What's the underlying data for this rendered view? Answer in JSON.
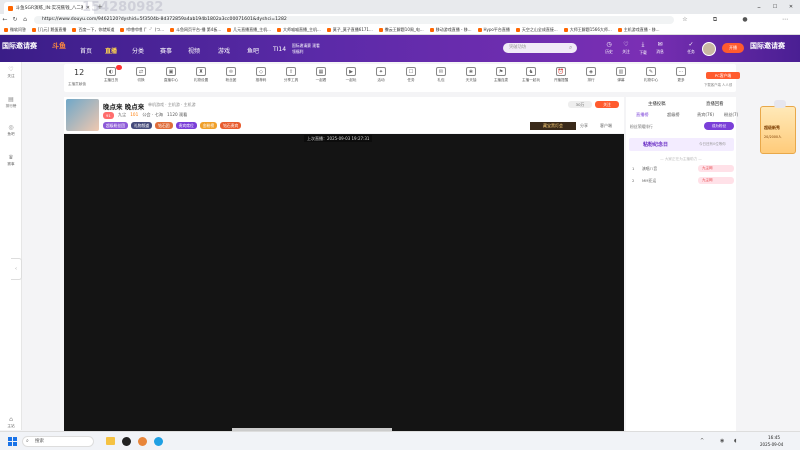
{
  "browser": {
    "tab_title": "斗鱼SGR演练_IN:实况蕉钱_八二赛",
    "url": "https://www.douyu.com/9462120?dyshid=5f3504b-8d372859a4ab194b1802a3cc00071601&dyshci=1282",
    "bookmarks": [
      "微软问答",
      "[几元] 鹅蛋直播",
      "百度一下，你就知道",
      "哔哩哔哩 (゜-゜)つ...",
      "斗鱼网页平台-播 第4板...",
      "几元直播直播_主机...",
      "大师喵喵直播_主机...",
      "莫子_莫子直播6171...",
      "撒云王解题10周_电...",
      "移动游戏直播 - 移...",
      "Hypo平台直播",
      "天空之山全成直接...",
      "大师王解题1566大师...",
      "主机游戏直播 - 移..."
    ]
  },
  "site": {
    "logo_left": "国际邀请赛",
    "logo_brand": "斗鱼",
    "nav": [
      "首页",
      "直播",
      "分类",
      "赛事",
      "视频",
      "游戏",
      "鱼吧",
      "TI14"
    ],
    "promo": "国际邀请赛 观看领福利",
    "search_placeholder": "突破功坊",
    "header_icons": [
      "历史",
      "关注",
      "下载",
      "消息",
      "任务"
    ],
    "right_logo": "国际邀请赛"
  },
  "sidebar": [
    "关注",
    "排行榜",
    "鱼吧",
    "赛事",
    "主站"
  ],
  "toolbar": {
    "level": "12",
    "level_label": "主播贡献值",
    "tools": [
      "主播日历",
      "切换",
      "直播中心",
      "礼物设置",
      "粉丝团",
      "推荐码",
      "分享工具",
      "一起看",
      "一起玩",
      "活动",
      "任务",
      "礼包",
      "天天抽",
      "主播连麦",
      "主播一起玩",
      "开播提醒",
      "排行",
      "弹幕",
      "礼物中心",
      "更多"
    ],
    "client_label": "PC客户端",
    "client_sub": "下载客户端 人人领"
  },
  "room": {
    "title": "晚点来 晚点来",
    "category": "单机游戏 · 主机游 · 主机游",
    "follow_count": "30万",
    "follow_label": "关注",
    "host": "九尘",
    "level": "101",
    "notice": "公会 · 七海",
    "fans": "1120 观看",
    "tags": [
      "超级粉丝团",
      "礼物频道",
      "钻石团",
      "贵宾席位",
      "金粉榜",
      "钻石贵宾"
    ],
    "share": "分享",
    "download": "客户端",
    "last_live": "上次直播：2025-09-03 19:27:31"
  },
  "right_panel": {
    "tabs": [
      "主播投稿",
      "直播回看"
    ],
    "subtabs": [
      "直播榜",
      "超级榜",
      "贵宾(76)",
      "粉丝(7)"
    ],
    "rank_title": "粉丝荣耀排行",
    "rank_btn": "成为粉丝",
    "anniv_title": "粘粉纪念日",
    "anniv_note": "今日还有0位等你",
    "rows": [
      {
        "num": "1",
        "name": "演唱八音",
        "badge": "九尘网"
      },
      {
        "num": "2",
        "name": "MM亚运",
        "badge": "九尘网"
      }
    ],
    "float_label": "超级新秀",
    "float_sub": "20/2000人"
  },
  "taskbar": {
    "search": "搜索",
    "time": "16:45",
    "date": "2025-09-04"
  },
  "watermark": "154280982"
}
